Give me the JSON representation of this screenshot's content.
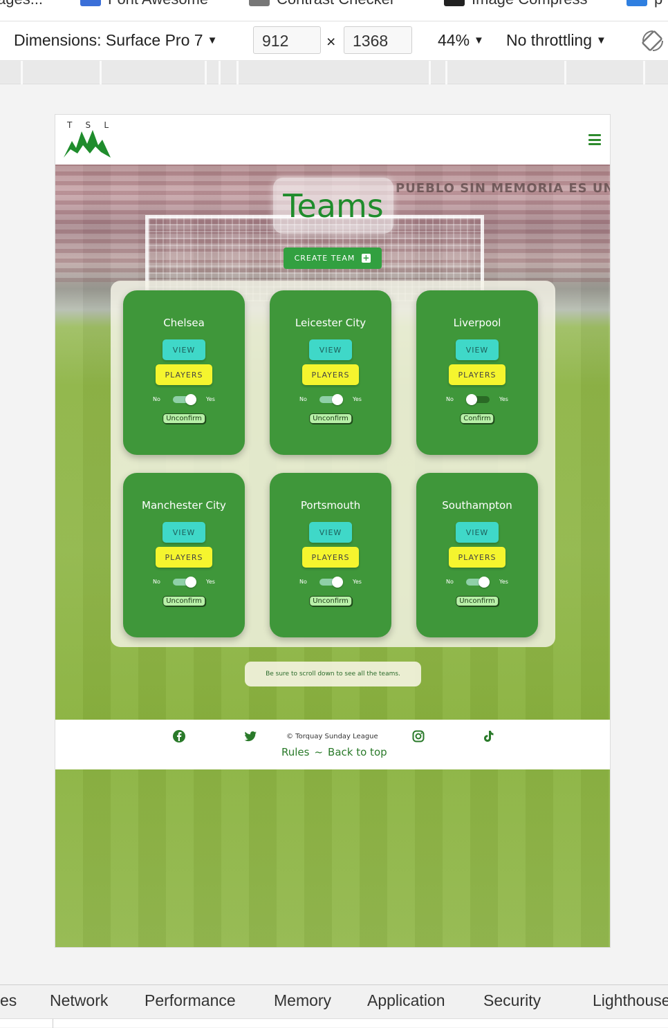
{
  "bookmarks": [
    {
      "label": "ages..."
    },
    {
      "label": "Font Awesome"
    },
    {
      "label": "Contrast Checker"
    },
    {
      "label": "Image Compress"
    },
    {
      "label": "p"
    }
  ],
  "devtools": {
    "dimensions_label": "Dimensions: Surface Pro 7",
    "width": "912",
    "times": "×",
    "height": "1368",
    "zoom": "44%",
    "throttling": "No throttling",
    "tabs": [
      "es",
      "Network",
      "Performance",
      "Memory",
      "Application",
      "Security",
      "Lighthouse"
    ]
  },
  "site": {
    "logo_letters": [
      "T",
      "S",
      "L"
    ],
    "page_title": "Teams",
    "create_team_label": "CREATE TEAM",
    "create_team_icon": "plus-square-icon",
    "banner_text": "PUEBLO SIN MEMORIA ES UN",
    "teams": [
      {
        "name": "Chelsea",
        "view": "VIEW",
        "players": "PLAYERS",
        "no": "No",
        "yes": "Yes",
        "toggle_on": true,
        "confirm": "Unconfirm"
      },
      {
        "name": "Leicester City",
        "view": "VIEW",
        "players": "PLAYERS",
        "no": "No",
        "yes": "Yes",
        "toggle_on": true,
        "confirm": "Unconfirm"
      },
      {
        "name": "Liverpool",
        "view": "VIEW",
        "players": "PLAYERS",
        "no": "No",
        "yes": "Yes",
        "toggle_on": false,
        "confirm": "Confirm"
      },
      {
        "name": "Manchester City",
        "view": "VIEW",
        "players": "PLAYERS",
        "no": "No",
        "yes": "Yes",
        "toggle_on": true,
        "confirm": "Unconfirm"
      },
      {
        "name": "Portsmouth",
        "view": "VIEW",
        "players": "PLAYERS",
        "no": "No",
        "yes": "Yes",
        "toggle_on": true,
        "confirm": "Unconfirm"
      },
      {
        "name": "Southampton",
        "view": "VIEW",
        "players": "PLAYERS",
        "no": "No",
        "yes": "Yes",
        "toggle_on": true,
        "confirm": "Unconfirm"
      }
    ],
    "scroll_note": "Be sure to scroll down to see all the teams.",
    "footer": {
      "copyright": "© Torquay Sunday League",
      "rules": "Rules",
      "separator": "~",
      "back_to_top": "Back to top",
      "icons": [
        "facebook-icon",
        "twitter-icon",
        "instagram-icon",
        "tiktok-icon"
      ]
    },
    "colors": {
      "brand_green": "#1f8c2c",
      "card_green": "#3f973a",
      "view_teal": "#3fd8c8",
      "players_yellow": "#f5f52e"
    }
  }
}
